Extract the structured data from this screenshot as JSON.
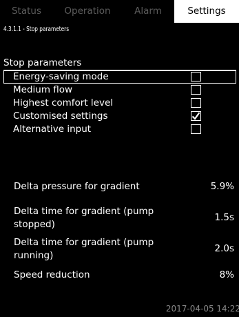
{
  "tabs": [
    {
      "label": "Status",
      "active": false
    },
    {
      "label": "Operation",
      "active": false
    },
    {
      "label": "Alarm",
      "active": false
    },
    {
      "label": "Settings",
      "active": true
    }
  ],
  "page_title": "4.3.1.1 - Stop parameters",
  "section_title": "Stop parameters",
  "options": [
    {
      "label": "Energy-saving mode",
      "checked": false,
      "selected": true
    },
    {
      "label": "Medium flow",
      "checked": false,
      "selected": false
    },
    {
      "label": "Highest comfort level",
      "checked": false,
      "selected": false
    },
    {
      "label": "Customised settings",
      "checked": true,
      "selected": false
    },
    {
      "label": "Alternative input",
      "checked": false,
      "selected": false
    }
  ],
  "parameters": [
    {
      "label": "Delta pressure for gradient",
      "value": "5.9%"
    },
    {
      "label": "Delta time for gradient (pump stopped)",
      "value": "1.5s"
    },
    {
      "label": "Delta time for gradient (pump running)",
      "value": "2.0s"
    },
    {
      "label": "Speed reduction",
      "value": "8%"
    }
  ],
  "timestamp": "2017-04-05 14:22",
  "colors": {
    "background": "#000000",
    "foreground": "#ffffff",
    "inactive_tab": "#5c5c5c",
    "timestamp": "#888888"
  }
}
